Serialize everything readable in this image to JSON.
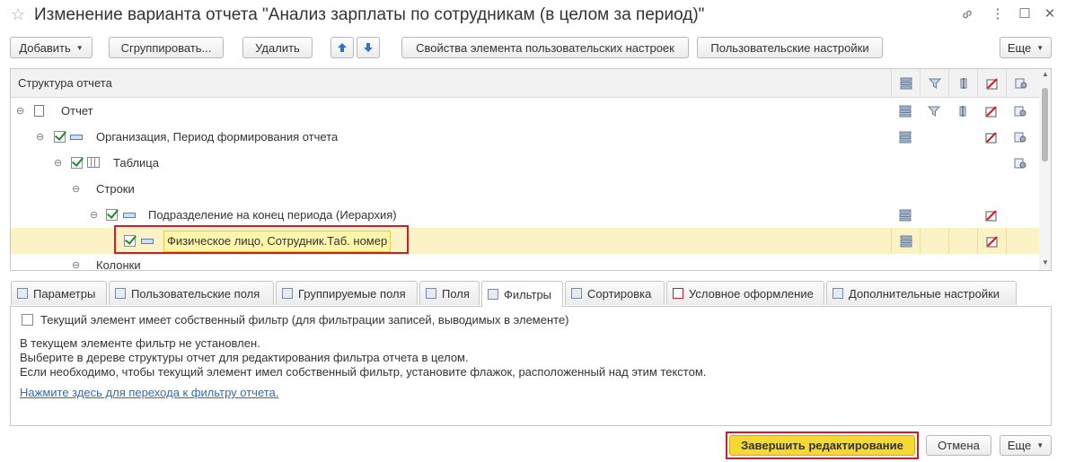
{
  "window": {
    "title": "Изменение варианта отчета \"Анализ зарплаты по сотрудникам (в целом за период)\""
  },
  "toolbar": {
    "add": "Добавить",
    "group": "Сгруппировать...",
    "delete": "Удалить",
    "element_props": "Свойства элемента пользовательских настроек",
    "user_settings": "Пользовательские настройки",
    "more": "Еще"
  },
  "tree": {
    "header": "Структура отчета",
    "rows": [
      {
        "label": "Отчет"
      },
      {
        "label": "Организация, Период формирования отчета"
      },
      {
        "label": "Таблица"
      },
      {
        "label": "Строки"
      },
      {
        "label": "Подразделение на конец периода (Иерархия)"
      },
      {
        "label": "Физическое лицо, Сотрудник.Таб. номер"
      },
      {
        "label": "Колонки"
      }
    ]
  },
  "tabs": [
    {
      "label": "Параметры"
    },
    {
      "label": "Пользовательские поля"
    },
    {
      "label": "Группируемые поля"
    },
    {
      "label": "Поля"
    },
    {
      "label": "Фильтры"
    },
    {
      "label": "Сортировка"
    },
    {
      "label": "Условное оформление"
    },
    {
      "label": "Дополнительные настройки"
    }
  ],
  "filter_panel": {
    "own_filter_checkbox": "Текущий элемент имеет собственный фильтр (для фильтрации записей, выводимых в элементе)",
    "own_filter_checked": false,
    "info_line1": "В текущем элементе фильтр не установлен.",
    "info_line2": "Выберите в дереве структуры отчет для редактирования фильтра отчета в целом.",
    "info_line3": "Если необходимо, чтобы текущий элемент имел собственный фильтр, установите флажок, расположенный над этим текстом.",
    "link": "Нажмите здесь для перехода к фильтру отчета."
  },
  "footer": {
    "finish": "Завершить редактирование",
    "cancel": "Отмена",
    "more": "Еще"
  },
  "colors": {
    "finish_button": "#f5d932",
    "highlight_row": "#fbf3c5",
    "annotation_border": "#d41a28",
    "link": "#2f6cb0"
  }
}
